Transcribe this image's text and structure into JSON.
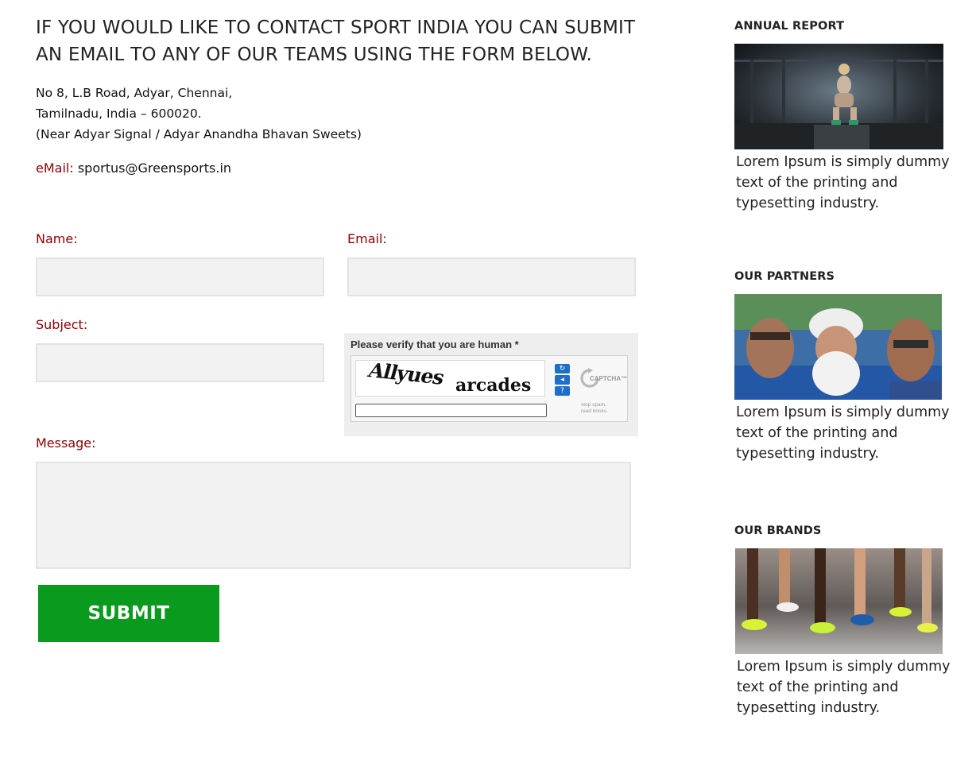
{
  "contact": {
    "heading": "IF YOU WOULD LIKE TO CONTACT SPORT INDIA YOU CAN SUBMIT AN EMAIL TO ANY OF OUR TEAMS USING THE FORM BELOW.",
    "address_lines": [
      "No 8, L.B Road, Adyar, Chennai,",
      "Tamilnadu, India – 600020.",
      "(Near Adyar Signal / Adyar Anandha Bhavan Sweets)"
    ],
    "email_label": "eMail:",
    "email_value": "sportus@Greensports.in"
  },
  "form": {
    "name_label": "Name:",
    "name_value": "",
    "email_label": "Email:",
    "email_value": "",
    "subject_label": "Subject:",
    "subject_value": "",
    "message_label": "Message:",
    "message_value": "",
    "submit_label": "SUBMIT"
  },
  "captcha": {
    "title": "Please verify that you are human *",
    "word1": "Allyues",
    "word2": "arcades",
    "input_value": "",
    "logo_text": "CAPTCHA™",
    "tagline_1": "stop spam.",
    "tagline_2": "read books."
  },
  "sidebar": {
    "sections": [
      {
        "title": "ANNUAL REPORT",
        "image": "athlete-box-jump-photo",
        "text": "Lorem Ipsum is simply dummy text of the printing and typesetting industry."
      },
      {
        "title": "OUR PARTNERS",
        "image": "three-men-selfie-photo",
        "text": "Lorem Ipsum is simply dummy text of the printing and typesetting industry."
      },
      {
        "title": "OUR BRANDS",
        "image": "runners-shoes-photo",
        "text": "Lorem Ipsum is simply dummy text of the printing and typesetting industry."
      }
    ]
  },
  "colors": {
    "label_red": "#8b0000",
    "submit_green": "#0a9a1e",
    "field_bg": "#f2f2f2"
  }
}
